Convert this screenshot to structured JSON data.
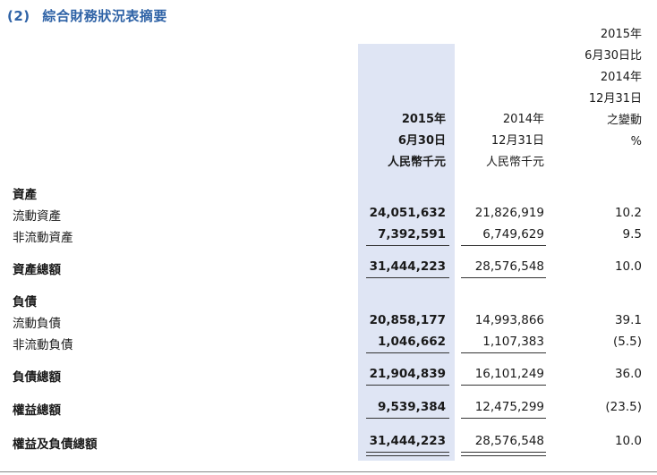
{
  "section": {
    "number": "(2)",
    "title": "綜合財務狀況表摘要"
  },
  "headers": {
    "col1": [
      "2015年",
      "6月30日",
      "人民幣千元"
    ],
    "col2": [
      "2014年",
      "12月31日",
      "人民幣千元"
    ],
    "col3": [
      "2015年",
      "6月30日比",
      "2014年",
      "12月31日",
      "之變動",
      "%"
    ]
  },
  "rows": {
    "assets_heading": {
      "label": "資產"
    },
    "current_assets": {
      "label": "流動資產",
      "v1": "24,051,632",
      "v2": "21,826,919",
      "v3": "10.2"
    },
    "noncurrent_assets": {
      "label": "非流動資產",
      "v1": "7,392,591",
      "v2": "6,749,629",
      "v3": "9.5"
    },
    "total_assets": {
      "label": "資產總額",
      "v1": "31,444,223",
      "v2": "28,576,548",
      "v3": "10.0"
    },
    "liabilities_heading": {
      "label": "負債"
    },
    "current_liabilities": {
      "label": "流動負債",
      "v1": "20,858,177",
      "v2": "14,993,866",
      "v3": "39.1"
    },
    "noncurrent_liabilities": {
      "label": "非流動負債",
      "v1": "1,046,662",
      "v2": "1,107,383",
      "v3": "(5.5)"
    },
    "total_liabilities": {
      "label": "負債總額",
      "v1": "21,904,839",
      "v2": "16,101,249",
      "v3": "36.0"
    },
    "total_equity": {
      "label": "權益總額",
      "v1": "9,539,384",
      "v2": "12,475,299",
      "v3": "(23.5)"
    },
    "total_equity_liabilities": {
      "label": "權益及負債總額",
      "v1": "31,444,223",
      "v2": "28,576,548",
      "v3": "10.0"
    }
  }
}
